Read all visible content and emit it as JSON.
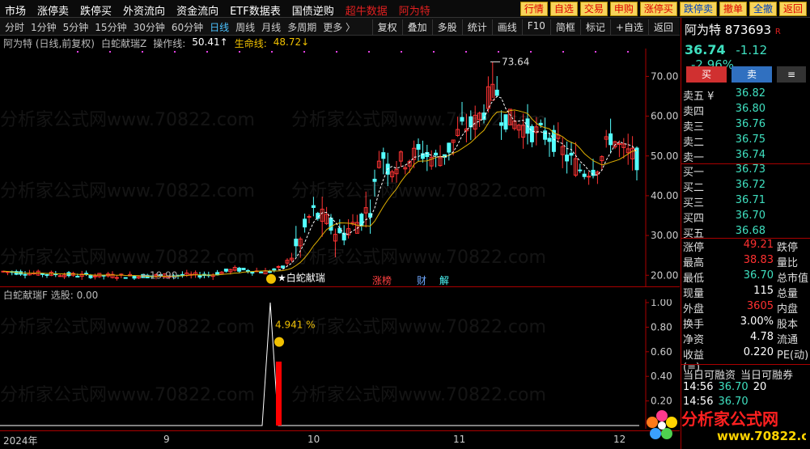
{
  "menu": [
    "市场",
    "涨停卖",
    "跌停买",
    "外资流向",
    "资金流向",
    "ETF数据表",
    "国债逆购",
    "超牛数据",
    "阿为特"
  ],
  "top_buttons": [
    "行情",
    "自选",
    "交易",
    "申购",
    "涨停买",
    "跌停卖",
    "撤单",
    "全撤",
    "返回"
  ],
  "periods": [
    "分时",
    "1分钟",
    "5分钟",
    "15分钟",
    "30分钟",
    "60分钟",
    "日线",
    "周线",
    "月线",
    "多周期",
    "更多 〉"
  ],
  "active_period": "日线",
  "tools": [
    "复权",
    "叠加",
    "多股",
    "统计",
    "画线",
    "F10",
    "简框",
    "标记",
    "+自选",
    "返回"
  ],
  "chart_header": {
    "title": "阿为特 (日线,前复权)",
    "indicator": "白蛇献瑞Z",
    "op_label": "操作线:",
    "op_value": "50.41↑",
    "life_label": "生命线:",
    "life_value": "48.72↓"
  },
  "chart_data": {
    "type": "candlestick",
    "ylim": [
      17,
      77
    ],
    "yticks": [
      20.0,
      30.0,
      40.0,
      50.0,
      60.0,
      70.0
    ],
    "xlabels": [
      "2024年",
      "9",
      "10",
      "11",
      "12"
    ],
    "high_label": "73.64",
    "low_label": "←19.90",
    "signal_label": "★白蛇献瑞",
    "markers": [
      "涨榜",
      "财",
      "解"
    ]
  },
  "indicator_panel": {
    "title": "白蛇献瑞F 选股: 0.00",
    "pct_label": "4.941 %",
    "yticks": [
      "1.00",
      "0.80",
      "0.60",
      "0.40",
      "0.20"
    ]
  },
  "quote": {
    "name": "阿为特",
    "code": "873693",
    "tag": "R",
    "price": "36.74",
    "change": "-1.12",
    "change_pct": "-2.96%",
    "buy": "买",
    "sell": "卖",
    "sells": [
      {
        "label": "卖五 ¥",
        "price": "36.82"
      },
      {
        "label": "卖四",
        "price": "36.80"
      },
      {
        "label": "卖三",
        "price": "36.76"
      },
      {
        "label": "卖二",
        "price": "36.75"
      },
      {
        "label": "卖一",
        "price": "36.74"
      }
    ],
    "buys": [
      {
        "label": "买一",
        "price": "36.73"
      },
      {
        "label": "买二",
        "price": "36.72"
      },
      {
        "label": "买三",
        "price": "36.71"
      },
      {
        "label": "买四",
        "price": "36.70"
      },
      {
        "label": "买五",
        "price": "36.68"
      }
    ],
    "stats": [
      {
        "k": "涨停",
        "v": "49.21",
        "vc": "red",
        "k2": "跌停"
      },
      {
        "k": "最高",
        "v": "38.83",
        "vc": "red",
        "k2": "量比"
      },
      {
        "k": "最低",
        "v": "36.70",
        "vc": "cyan",
        "k2": "总市值"
      },
      {
        "k": "现量",
        "v": "115",
        "vc": "white",
        "k2": "总量"
      },
      {
        "k": "外盘",
        "v": "3605",
        "vc": "red",
        "k2": "内盘"
      },
      {
        "k": "换手",
        "v": "3.00%",
        "vc": "white",
        "k2": "股本"
      },
      {
        "k": "净资",
        "v": "4.78",
        "vc": "white",
        "k2": "流通"
      },
      {
        "k": "收益(=)",
        "v": "0.220",
        "vc": "white",
        "k2": "PE(动)"
      }
    ],
    "margin_header": [
      "当日可融资",
      "当日可融券"
    ],
    "ticks": [
      {
        "t": "14:56",
        "p": "36.70",
        "v": "20"
      },
      {
        "t": "14:56",
        "p": "36.70",
        "v": ""
      }
    ]
  },
  "watermark_text": "分析家公式网www.70822.com",
  "logo": {
    "text": "分析家公式网",
    "url": "www.70822.com"
  },
  "colors": {
    "up": "#ff3333",
    "down": "#54ffff",
    "ma": "#e0b000",
    "bg": "#000000"
  }
}
